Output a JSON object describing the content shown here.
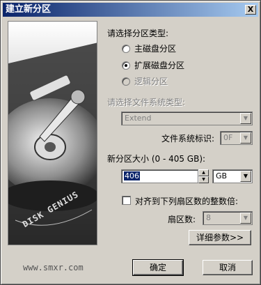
{
  "window": {
    "title": "建立新分区",
    "close_glyph": "X"
  },
  "side_panel": {
    "brand_text": "DISK GENIUS"
  },
  "footer": {
    "website": "www.smxr.com"
  },
  "partition_type": {
    "label": "请选择分区类型:",
    "options": [
      {
        "label": "主磁盘分区",
        "selected": false,
        "enabled": true
      },
      {
        "label": "扩展磁盘分区",
        "selected": true,
        "enabled": true
      },
      {
        "label": "逻辑分区",
        "selected": false,
        "enabled": false
      }
    ]
  },
  "filesystem": {
    "label": "请选择文件系统类型:",
    "value": "Extend",
    "id_label": "文件系统标识:",
    "id_value": "0F"
  },
  "size": {
    "label": "新分区大小 (0 - 405 GB):",
    "value": "406",
    "unit": "GB"
  },
  "align": {
    "label": "对齐到下列扇区数的整数倍:",
    "checked": false,
    "sectors_label": "扇区数:",
    "sectors_value": "8"
  },
  "buttons": {
    "details": "详细参数>>",
    "ok": "确定",
    "cancel": "取消"
  }
}
